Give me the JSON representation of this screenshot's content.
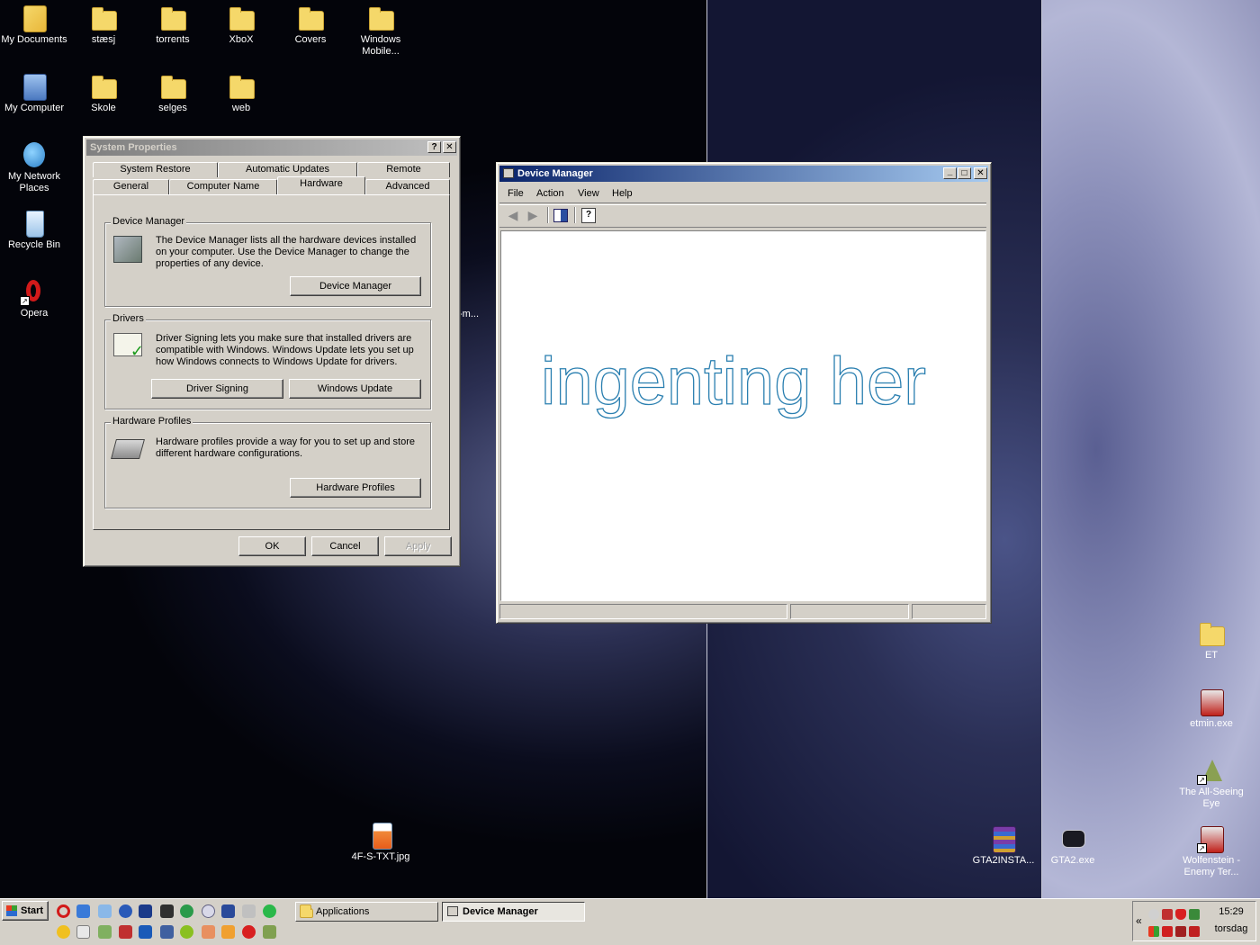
{
  "desktop": {
    "icons": [
      {
        "label": "My Documents"
      },
      {
        "label": "stæsj"
      },
      {
        "label": "torrents"
      },
      {
        "label": "XboX"
      },
      {
        "label": "Covers"
      },
      {
        "label": "Windows Mobile..."
      },
      {
        "label": "My Computer"
      },
      {
        "label": "Skole"
      },
      {
        "label": "selges"
      },
      {
        "label": "web"
      },
      {
        "label": "My Network Places"
      },
      {
        "label": "Recycle Bin"
      },
      {
        "label": "Opera"
      },
      {
        "label": "4F-S-TXT.jpg"
      },
      {
        "label": "GTA2INSTA..."
      },
      {
        "label": "GTA2.exe"
      },
      {
        "label": "ET"
      },
      {
        "label": "etmin.exe"
      },
      {
        "label": "The All-Seeing Eye"
      },
      {
        "label": "Wolfenstein - Enemy Ter..."
      }
    ],
    "partial_label": "-m..."
  },
  "system_properties": {
    "title": "System Properties",
    "help_btn": "?",
    "close_btn": "✕",
    "tabs_row1": [
      "System Restore",
      "Automatic Updates",
      "Remote"
    ],
    "tabs_row2": [
      "General",
      "Computer Name",
      "Hardware",
      "Advanced"
    ],
    "device_manager_group": {
      "label": "Device Manager",
      "text": "The Device Manager lists all the hardware devices installed on your computer. Use the Device Manager to change the properties of any device.",
      "button": "Device Manager"
    },
    "drivers_group": {
      "label": "Drivers",
      "text": "Driver Signing lets you make sure that installed drivers are compatible with Windows. Windows Update lets you set up how Windows connects to Windows Update for drivers.",
      "button1": "Driver Signing",
      "button2": "Windows Update"
    },
    "hardware_profiles_group": {
      "label": "Hardware Profiles",
      "text": "Hardware profiles provide a way for you to set up and store different hardware configurations.",
      "button": "Hardware Profiles"
    },
    "ok": "OK",
    "cancel": "Cancel",
    "apply": "Apply"
  },
  "device_manager": {
    "title": "Device Manager",
    "menu": [
      "File",
      "Action",
      "View",
      "Help"
    ],
    "content_text": "ingenting her",
    "content_color": "#2a7fb0"
  },
  "taskbar": {
    "start": "Start",
    "tasks": [
      {
        "label": "Applications"
      },
      {
        "label": "Device Manager"
      }
    ],
    "tray_expand": "«",
    "clock": "15:29",
    "day": "torsdag"
  }
}
